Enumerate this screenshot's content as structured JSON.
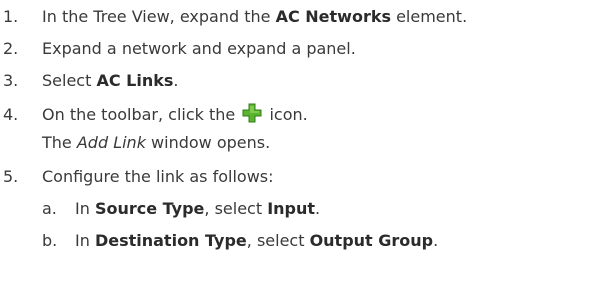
{
  "steps": [
    {
      "num": "1.",
      "pre": "In the Tree View, expand the ",
      "bold": "AC Networks",
      "post": " element."
    },
    {
      "num": "2.",
      "text": "Expand a network and expand a panel."
    },
    {
      "num": "3.",
      "pre": "Select ",
      "bold": "AC Links",
      "post": "."
    },
    {
      "num": "4.",
      "pre": "On the toolbar, click the ",
      "icon": "green-plus-icon",
      "post": " icon.",
      "result_pre": "The ",
      "result_italic": "Add Link",
      "result_post": " window opens."
    },
    {
      "num": "5.",
      "text": "Configure the link as follows:",
      "substeps": [
        {
          "num": "a.",
          "pre": "In ",
          "bold1": "Source Type",
          "mid": ", select ",
          "bold2": "Input",
          "post": "."
        },
        {
          "num": "b.",
          "pre": "In ",
          "bold1": "Destination Type",
          "mid": ", select ",
          "bold2": "Output Group",
          "post": "."
        }
      ]
    }
  ],
  "colors": {
    "text": "#3a3a3a",
    "icon_green": "#5cb32e",
    "icon_dark_green": "#2f7d18"
  }
}
